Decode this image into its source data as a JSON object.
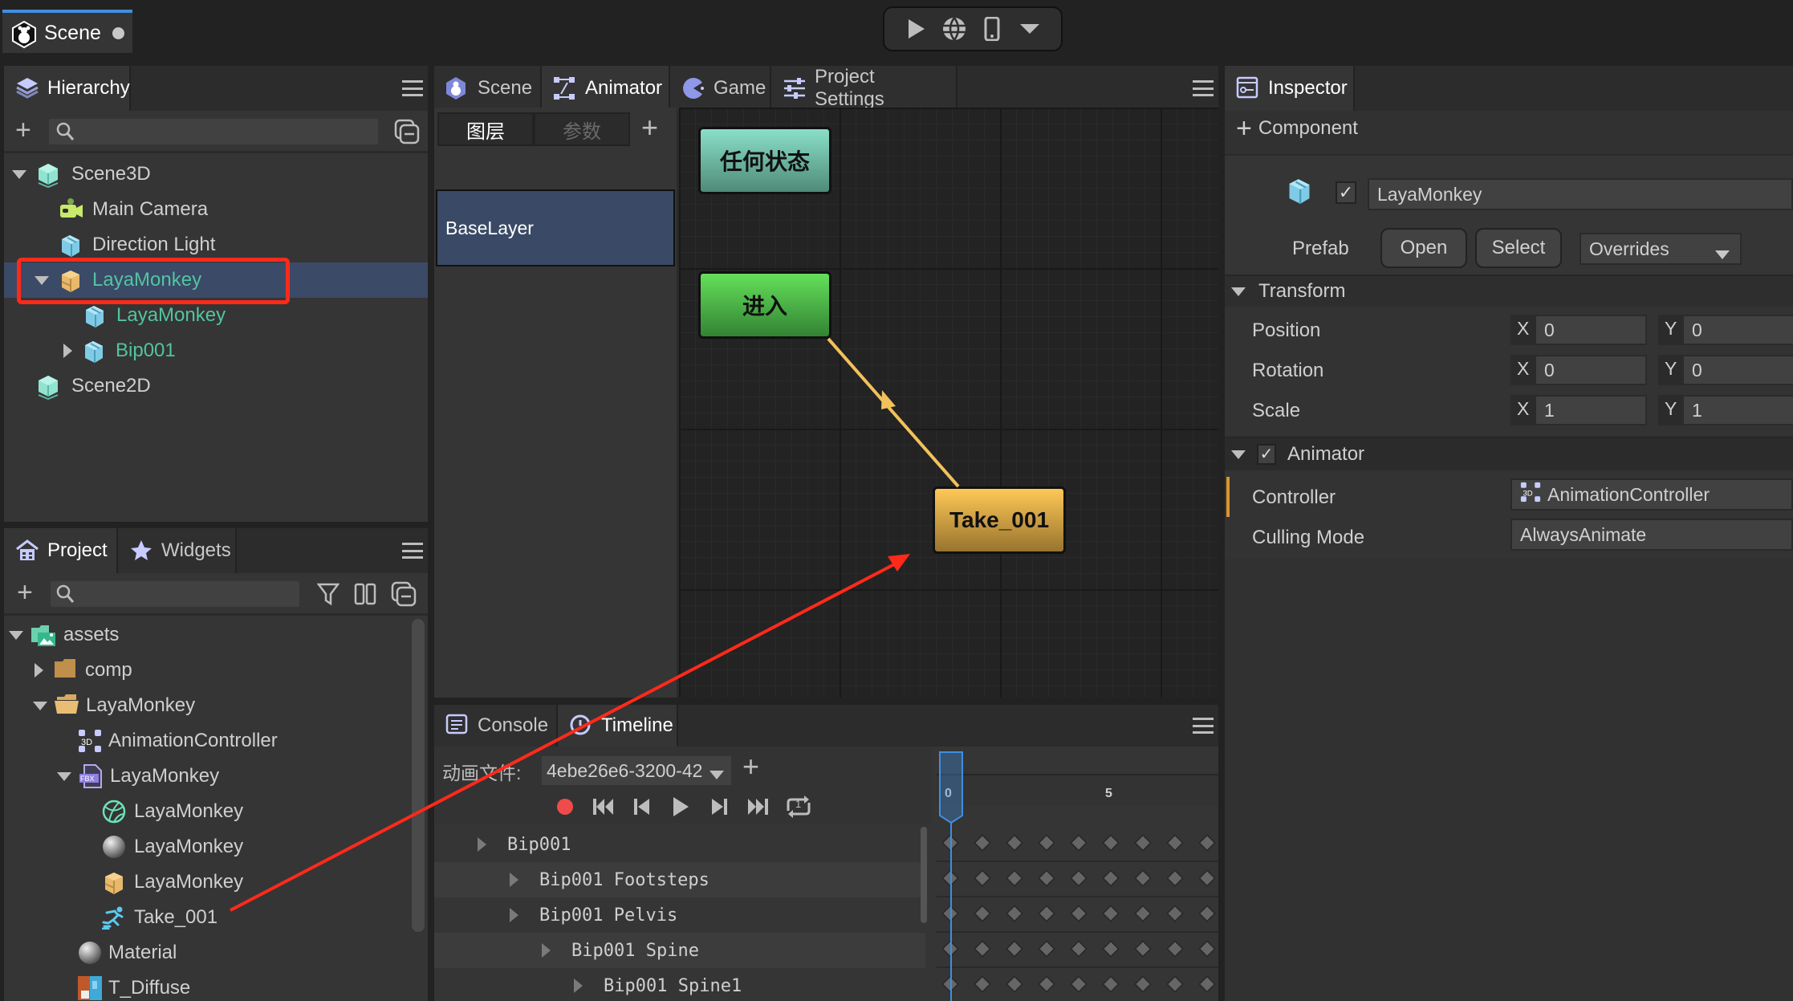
{
  "window": {
    "doc_tab": "Scene",
    "unsaved_dot": true
  },
  "toolbar": {
    "play_icon": "play-icon",
    "web_icon": "globe-icon",
    "device_icon": "phone-icon",
    "more_icon": "dropdown-icon"
  },
  "hierarchy": {
    "tab_label": "Hierarchy",
    "search_placeholder": "",
    "items": [
      {
        "label": "Scene3D",
        "icon": "scene3d-icon",
        "expanded": true,
        "depth": 0
      },
      {
        "label": "Main Camera",
        "icon": "camera-icon",
        "depth": 1
      },
      {
        "label": "Direction Light",
        "icon": "cube-icon",
        "depth": 1
      },
      {
        "label": "LayaMonkey",
        "icon": "prefab-icon",
        "expanded": true,
        "depth": 1,
        "selected": true,
        "highlighted": true
      },
      {
        "label": "LayaMonkey",
        "icon": "cube-icon",
        "depth": 2,
        "prefab_child": true
      },
      {
        "label": "Bip001",
        "icon": "cube-icon",
        "depth": 2,
        "collapsed": true,
        "prefab_child": true
      },
      {
        "label": "Scene2D",
        "icon": "scene2d-icon",
        "depth": 0
      }
    ]
  },
  "project": {
    "tabs": [
      "Project",
      "Widgets"
    ],
    "items": [
      {
        "label": "assets",
        "icon": "assets-folder-icon",
        "expanded": true
      },
      {
        "label": "comp",
        "icon": "folder-icon",
        "collapsed": true
      },
      {
        "label": "LayaMonkey",
        "icon": "folder-open-icon",
        "expanded": true
      },
      {
        "label": "AnimationController",
        "icon": "animation-controller-icon"
      },
      {
        "label": "LayaMonkey",
        "icon": "fbx-icon",
        "expanded": true
      },
      {
        "label": "LayaMonkey",
        "icon": "mesh-icon"
      },
      {
        "label": "LayaMonkey",
        "icon": "material-sphere-icon"
      },
      {
        "label": "LayaMonkey",
        "icon": "prefab-icon"
      },
      {
        "label": "Take_001",
        "icon": "animation-clip-icon"
      },
      {
        "label": "Material",
        "icon": "material-sphere-icon"
      },
      {
        "label": "T_Diffuse",
        "icon": "texture-icon"
      }
    ]
  },
  "center": {
    "tabs": [
      "Scene",
      "Animator",
      "Game",
      "Project Settings"
    ],
    "active_tab": "Animator",
    "layer_tabs": [
      "图层",
      "参数"
    ],
    "layers": [
      "BaseLayer"
    ],
    "states": {
      "any": "任何状态",
      "entry": "进入",
      "clip": "Take_001"
    },
    "colors": {
      "any": "#6fcbb0",
      "entry": "#4fbf4b",
      "clip": "#e9b44c",
      "transition": "#f2c15a",
      "annotation": "#ff2a1a"
    }
  },
  "bottom": {
    "tabs": [
      "Console",
      "Timeline"
    ],
    "active_tab": "Timeline",
    "anim_file_label": "动画文件:",
    "anim_file_value": "4ebe26e6-3200-42",
    "ruler": {
      "labels": [
        "0",
        "5"
      ],
      "current_frame": 0
    },
    "loop_count": "1",
    "tracks": [
      {
        "label": "Bip001",
        "depth": 0
      },
      {
        "label": "Bip001 Footsteps",
        "depth": 1
      },
      {
        "label": "Bip001 Pelvis",
        "depth": 1
      },
      {
        "label": "Bip001 Spine",
        "depth": 2
      },
      {
        "label": "Bip001 Spine1",
        "depth": 3
      }
    ],
    "keyframes_per_row": 9
  },
  "inspector": {
    "tab_label": "Inspector",
    "add_component": "Component",
    "node_name": "LayaMonkey",
    "node_active": true,
    "prefab_label": "Prefab",
    "open_btn": "Open",
    "select_btn": "Select",
    "overrides": "Overrides",
    "transform": {
      "title": "Transform",
      "rows": [
        {
          "label": "Position",
          "x": "0",
          "y": "0"
        },
        {
          "label": "Rotation",
          "x": "0",
          "y": "0"
        },
        {
          "label": "Scale",
          "x": "1",
          "y": "1"
        }
      ]
    },
    "animator": {
      "title": "Animator",
      "enabled": true,
      "controller_label": "Controller",
      "controller_value": "AnimationController",
      "culling_label": "Culling Mode",
      "culling_value": "AlwaysAnimate"
    }
  }
}
